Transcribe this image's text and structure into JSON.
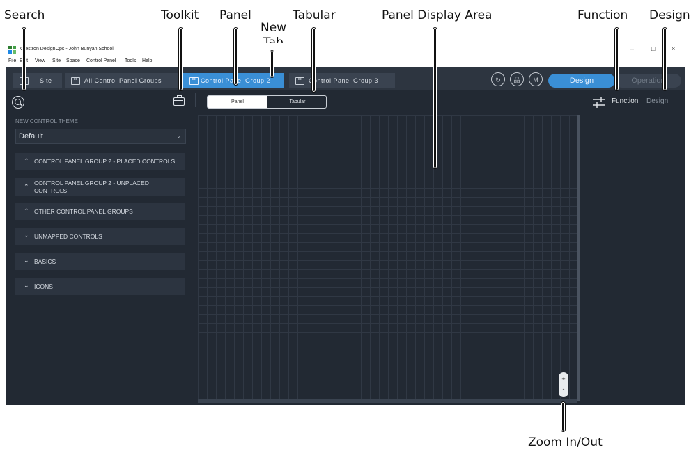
{
  "annotations": {
    "search": "Search",
    "toolkit": "Toolkit",
    "panel": "Panel",
    "new_tab_1": "New",
    "new_tab_2": "Tab",
    "tabular": "Tabular",
    "panel_display_area": "Panel Display Area",
    "function": "Function",
    "design": "Design",
    "zoom": "Zoom In/Out"
  },
  "window": {
    "title": "Crestron DesignOps - John Bunyan School",
    "minimize": "–",
    "maximize": "□",
    "close": "×"
  },
  "menu": [
    "File",
    "Edit",
    "View",
    "Site",
    "Space",
    "Control Panel",
    "Tools",
    "Help"
  ],
  "tabs": {
    "site": "Site",
    "all_groups": "All Control Panel Groups",
    "group2": "Control Panel Group 2",
    "group3": "Control Panel Group 3"
  },
  "header_buttons": {
    "sync": "↻",
    "hierarchy": "品",
    "user": "M",
    "design": "Design",
    "operation": "Operation"
  },
  "left_panel": {
    "theme_label": "NEW CONTROL THEME",
    "theme_value": "Default",
    "sections": [
      {
        "label": "CONTROL PANEL GROUP 2 - PLACED CONTROLS",
        "chevron": "^"
      },
      {
        "label": "CONTROL PANEL GROUP 2 - UNPLACED CONTROLS",
        "chevron": "^"
      },
      {
        "label": "OTHER CONTROL PANEL GROUPS",
        "chevron": "^"
      },
      {
        "label": "UNMAPPED CONTROLS",
        "chevron": "v"
      },
      {
        "label": "BASICS",
        "chevron": "v"
      },
      {
        "label": "ICONS",
        "chevron": "v"
      }
    ]
  },
  "center": {
    "seg_panel": "Panel",
    "seg_tabular": "Tabular",
    "zoom_in": "+",
    "zoom_out": "-"
  },
  "right_panel": {
    "function_tab": "Function",
    "design_tab": "Design"
  },
  "colors": {
    "app_bg": "#222933",
    "accent": "#3a8fd6",
    "tabbar_bg": "#2d3540"
  }
}
